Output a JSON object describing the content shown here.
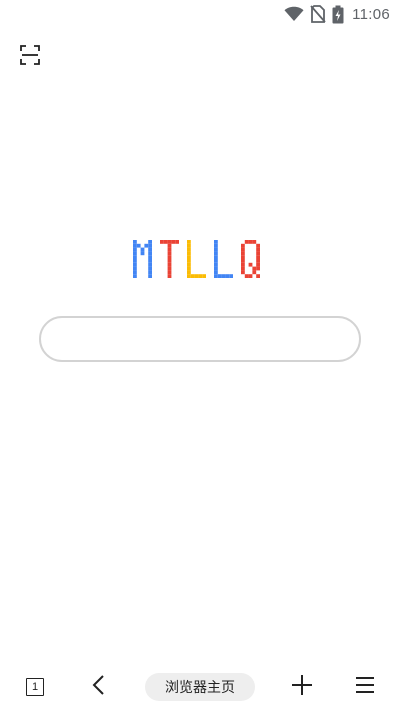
{
  "status_bar": {
    "time": "11:06",
    "icons": [
      "wifi-icon",
      "no-sim-icon",
      "battery-charging-icon"
    ]
  },
  "header": {
    "scan_icon": "scan-qr-icon"
  },
  "logo": {
    "text": "MTLLQ",
    "letters": [
      {
        "char": "M",
        "color": "#4285F4"
      },
      {
        "char": "T",
        "color": "#EA4335"
      },
      {
        "char": "L",
        "color": "#FBBC05"
      },
      {
        "char": "L",
        "color": "#4285F4"
      },
      {
        "char": "Q",
        "color": "#EA4335"
      }
    ]
  },
  "search": {
    "value": "",
    "placeholder": ""
  },
  "toolbar": {
    "tab_count": "1",
    "home_label": "浏览器主页",
    "icons": [
      "tabs-icon",
      "back-icon",
      "add-icon",
      "menu-icon"
    ]
  },
  "colors": {
    "icon": "#222222",
    "status": "#5f6368",
    "search_border": "#d3d3d3",
    "pill_bg": "#eeeeee"
  }
}
